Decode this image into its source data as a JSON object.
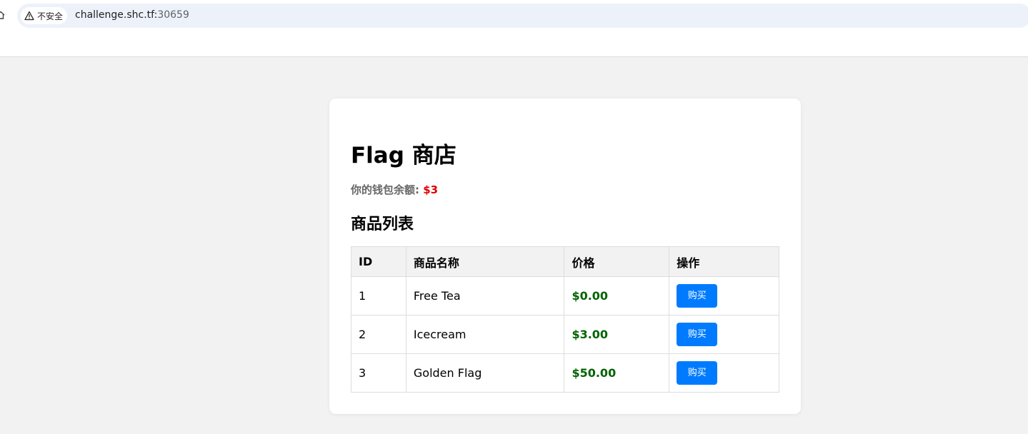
{
  "browser": {
    "security_label": "不安全",
    "url_host": "challenge.shc.tf:",
    "url_port": "30659",
    "icons": [
      "home-icon",
      "warning-icon"
    ]
  },
  "shop": {
    "title": "Flag 商店",
    "wallet_label": "你的钱包余额: ",
    "wallet_amount": "$3",
    "list_heading": "商品列表",
    "columns": [
      "ID",
      "商品名称",
      "价格",
      "操作"
    ],
    "items": [
      {
        "id": "1",
        "name": "Free Tea",
        "price": "$0.00",
        "action": "购买"
      },
      {
        "id": "2",
        "name": "Icecream",
        "price": "$3.00",
        "action": "购买"
      },
      {
        "id": "3",
        "name": "Golden Flag",
        "price": "$50.00",
        "action": "购买"
      }
    ],
    "colors": {
      "wallet_amount": "#e00000",
      "price": "#006400",
      "buy_button": "#007bff"
    }
  }
}
